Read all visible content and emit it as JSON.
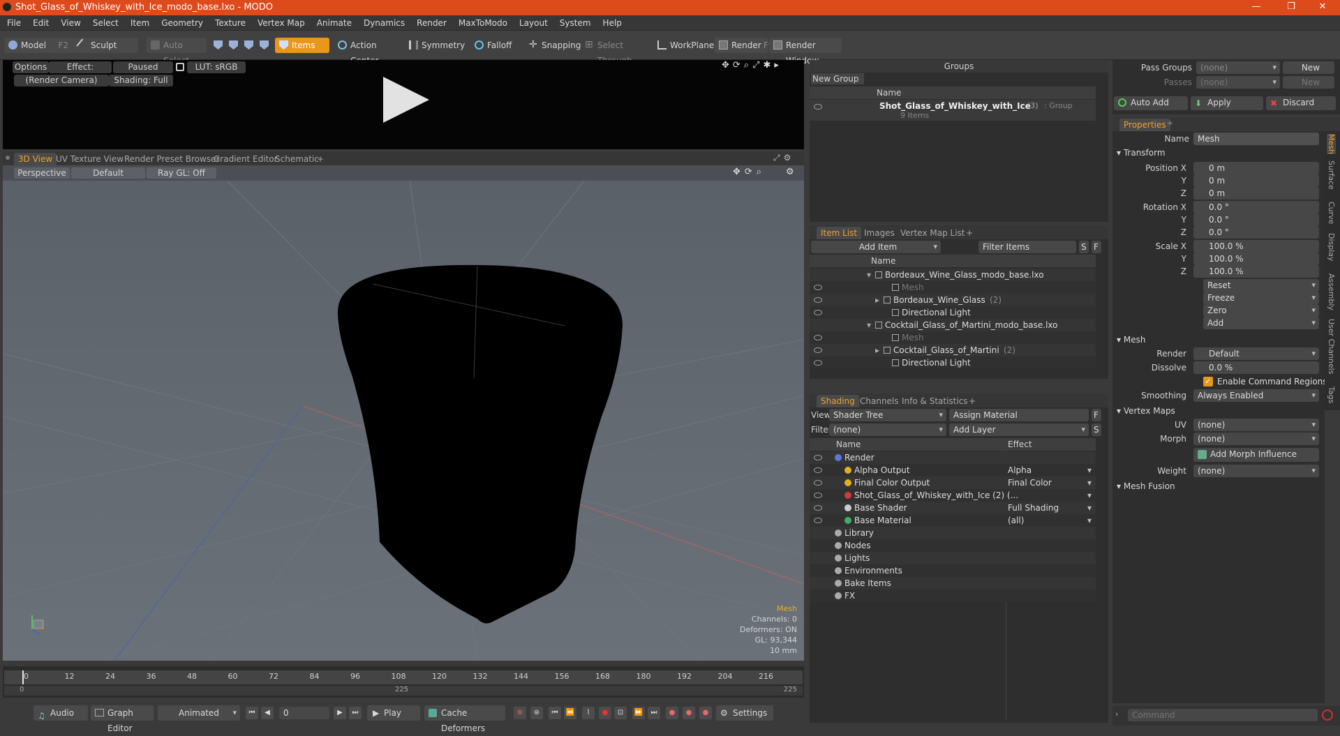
{
  "window": {
    "title": "Shot_Glass_of_Whiskey_with_Ice_modo_base.lxo - MODO",
    "controls": [
      "—",
      "❐",
      "✕"
    ]
  },
  "menu": [
    "File",
    "Edit",
    "View",
    "Select",
    "Item",
    "Geometry",
    "Texture",
    "Vertex Map",
    "Animate",
    "Dynamics",
    "Render",
    "MaxToModo",
    "Layout",
    "System",
    "Help"
  ],
  "toolbar": {
    "model": "Model",
    "model_key": "F2",
    "sculpt": "Sculpt",
    "auto_select": "Auto Select",
    "items": "Items",
    "action_center": "Action Center",
    "symmetry": "Symmetry",
    "falloff": "Falloff",
    "snapping": "Snapping",
    "select_through": "Select Through",
    "workplane": "WorkPlane",
    "render": "Render",
    "render_key": "F9",
    "render_window": "Render Window"
  },
  "preview": {
    "options": "Options",
    "effect": "Effect: (Shadi...",
    "paused": "Paused",
    "lut": "LUT: sRGB",
    "camera": "(Render Camera)",
    "shading": "Shading: Full"
  },
  "viewtabs": [
    "3D View",
    "UV Texture View",
    "Render Preset Browser",
    "Gradient Editor",
    "Schematic",
    "+"
  ],
  "viewport": {
    "perspective": "Perspective",
    "default": "Default",
    "raygl": "Ray GL: Off",
    "info": {
      "mesh": "Mesh",
      "channels": "Channels: 0",
      "deformers": "Deformers: ON",
      "gl": "GL: 93,344",
      "scale": "10 mm"
    }
  },
  "timeline": {
    "ticks": [
      "0",
      "12",
      "24",
      "36",
      "48",
      "60",
      "72",
      "84",
      "96",
      "108",
      "120",
      "132",
      "144",
      "156",
      "168",
      "180",
      "192",
      "204",
      "216"
    ],
    "start": "0",
    "mid": "225",
    "end": "225"
  },
  "bottom": {
    "audio": "Audio",
    "graph": "Graph Editor",
    "animated": "Animated",
    "frame": "0",
    "play": "Play",
    "cache": "Cache Deformers",
    "settings": "Settings"
  },
  "groups": {
    "title": "Groups",
    "new_group": "New Group",
    "col_name": "Name",
    "item": "Shot_Glass_of_Whiskey_with_Ice",
    "item_count": "(3)",
    "item_type": ": Group",
    "item_sub": "9 Items"
  },
  "itemlist": {
    "tabs": [
      "Item List",
      "Images",
      "Vertex Map List",
      "+"
    ],
    "add_item": "Add Item",
    "filter": "Filter Items",
    "s": "S",
    "f": "F",
    "col_name": "Name",
    "rows": [
      {
        "name": "Bordeaux_Wine_Glass_modo_base.lxo",
        "indent": 0
      },
      {
        "name": "Mesh",
        "indent": 2,
        "dim": true
      },
      {
        "name": "Bordeaux_Wine_Glass",
        "count": "(2)",
        "indent": 1
      },
      {
        "name": "Directional Light",
        "indent": 2
      },
      {
        "name": "Cocktail_Glass_of_Martini_modo_base.lxo",
        "indent": 0
      },
      {
        "name": "Mesh",
        "indent": 2,
        "dim": true
      },
      {
        "name": "Cocktail_Glass_of_Martini",
        "count": "(2)",
        "indent": 1
      },
      {
        "name": "Directional Light",
        "indent": 2
      }
    ]
  },
  "shading": {
    "tabs": [
      "Shading",
      "Channels",
      "Info & Statistics",
      "+"
    ],
    "view_label": "View",
    "view_value": "Shader Tree",
    "assign": "Assign Material",
    "f": "F",
    "filter_label": "Filter",
    "filter_value": "(none)",
    "add_layer": "Add Layer",
    "s": "S",
    "col_name": "Name",
    "col_effect": "Effect",
    "rows": [
      {
        "name": "Render",
        "effect": "",
        "indent": 0
      },
      {
        "name": "Alpha Output",
        "effect": "Alpha",
        "indent": 1
      },
      {
        "name": "Final Color Output",
        "effect": "Final Color",
        "indent": 1
      },
      {
        "name": "Shot_Glass_of_Whiskey_with_Ice (2) (...",
        "effect": "",
        "indent": 1
      },
      {
        "name": "Base Shader",
        "effect": "Full Shading",
        "indent": 1
      },
      {
        "name": "Base Material",
        "effect": "(all)",
        "indent": 1
      },
      {
        "name": "Library",
        "effect": "",
        "indent": 0
      },
      {
        "name": "Nodes",
        "effect": "",
        "indent": 0
      },
      {
        "name": "Lights",
        "effect": "",
        "indent": 0
      },
      {
        "name": "Environments",
        "effect": "",
        "indent": 0
      },
      {
        "name": "Bake Items",
        "effect": "",
        "indent": 0
      },
      {
        "name": "FX",
        "effect": "",
        "indent": 0
      }
    ]
  },
  "passes": {
    "pass_groups": "Pass Groups",
    "passes": "Passes",
    "none": "(none)",
    "new": "New",
    "auto_add": "Auto Add",
    "apply": "Apply",
    "discard": "Discard"
  },
  "properties": {
    "tab": "Properties",
    "name_label": "Name",
    "name_value": "Mesh",
    "transform": "Transform",
    "position": [
      "0 m",
      "0 m",
      "0 m"
    ],
    "rotation": [
      "0.0 °",
      "0.0 °",
      "0.0 °"
    ],
    "scale": [
      "100.0 %",
      "100.0 %",
      "100.0 %"
    ],
    "pos_label": "Position X",
    "rot_label": "Rotation X",
    "scale_label": "Scale X",
    "y": "Y",
    "z": "Z",
    "reset": "Reset",
    "freeze": "Freeze",
    "zero": "Zero",
    "add": "Add",
    "mesh": "Mesh",
    "render_label": "Render",
    "render_value": "Default",
    "dissolve_label": "Dissolve",
    "dissolve_value": "0.0 %",
    "cmd_regions": "Enable Command Regions",
    "smoothing_label": "Smoothing",
    "smoothing_value": "Always Enabled",
    "vertex_maps": "Vertex Maps",
    "uv_label": "UV",
    "uv_value": "(none)",
    "morph_label": "Morph",
    "morph_value": "(none)",
    "add_morph": "Add Morph Influence",
    "weight_label": "Weight",
    "weight_value": "(none)",
    "mesh_fusion": "Mesh Fusion",
    "side_tabs": [
      "Mesh",
      "Surface",
      "Curve",
      "Display",
      "Assembly",
      "User Channels",
      "Tags"
    ]
  },
  "command": {
    "placeholder": "Command"
  }
}
